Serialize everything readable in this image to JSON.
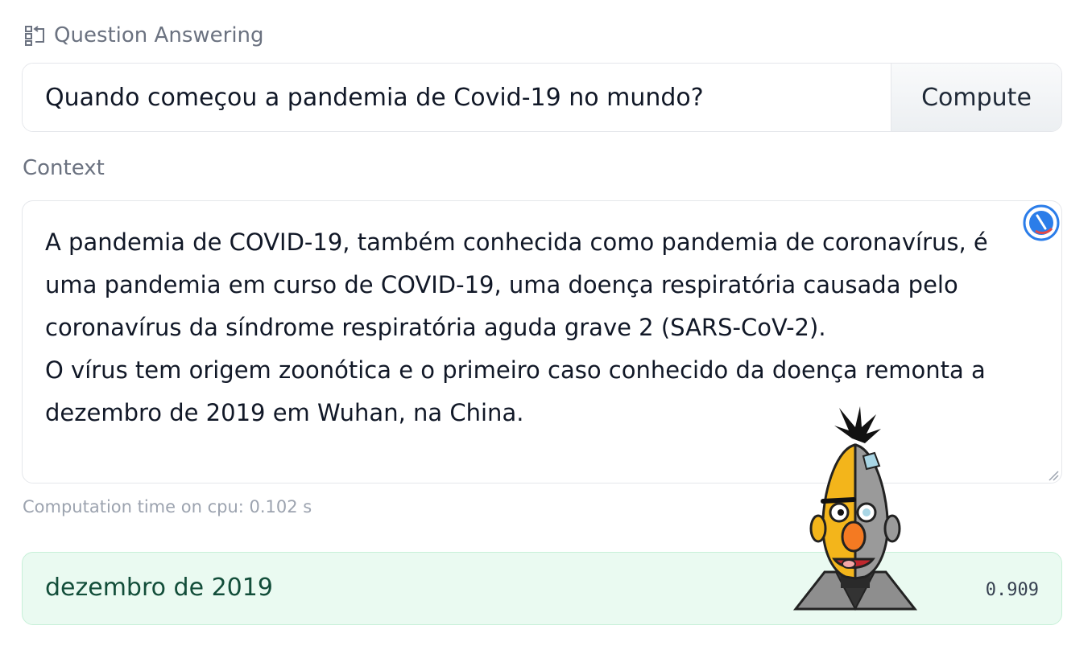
{
  "header": {
    "task_icon": "question-answering-icon",
    "task_label": "Question Answering"
  },
  "question": {
    "value": "Quando começou a pandemia de Covid-19 no mundo?",
    "compute_label": "Compute"
  },
  "context": {
    "label": "Context",
    "text": "A pandemia de COVID-19, também conhecida como pandemia de coronavírus, é\numa pandemia em curso de COVID-19, uma doença respiratória causada pelo\ncoronavírus da síndrome respiratória aguda grave 2 (SARS-CoV-2).\nO vírus tem origem zoonótica e o primeiro caso conhecido da doença remonta a\ndezembro de 2019 em Wuhan, na China.",
    "overlay_icon": "grammarly-icon"
  },
  "computation": {
    "text": "Computation time on cpu: 0.102 s"
  },
  "answer": {
    "text": "dezembro de 2019",
    "score": "0.909"
  },
  "mascot_icon": "bert-mascot-icon",
  "colors": {
    "answer_bg": "#eafaf1",
    "answer_text": "#134e3a",
    "muted_text": "#6b7280",
    "border": "#e5e7eb",
    "grammarly_blue": "#2b7de9"
  }
}
